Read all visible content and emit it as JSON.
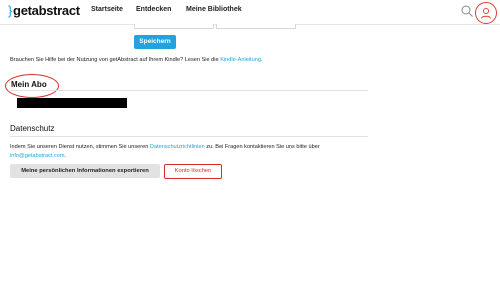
{
  "brand": {
    "brace": "}",
    "name": "getabstract",
    "accent": "#22a3d9"
  },
  "nav": {
    "items": [
      "Startseite",
      "Entdecken",
      "Meine Bibliothek"
    ]
  },
  "icons": {
    "search": "search-icon",
    "user": "user-icon"
  },
  "form": {
    "save_label": "Speichern",
    "button_color": "#22a3e0"
  },
  "help": {
    "prefix": "Brauchen Sie Hilfe bei der Nutzung von getAbstract auf Ihrem Kindle? Lesen Sie die ",
    "link": "Kindle-Anleitung",
    "suffix": "."
  },
  "abo": {
    "title": "Mein Abo",
    "highlight_color": "#d62f28"
  },
  "privacy": {
    "title": "Datenschutz",
    "text_prefix": "Indem Sie unseren Dienst nutzen, stimmen Sie unseren ",
    "policy_link": "Datenschutzrichtlinien",
    "text_middle": " zu. Bei Fragen kontaktieren Sie uns bitte über ",
    "email": "info@getabstract.com",
    "text_suffix": ".",
    "export_label": "Meine persönlichen Informationen exportieren",
    "delete_label": "Konto löschen"
  }
}
